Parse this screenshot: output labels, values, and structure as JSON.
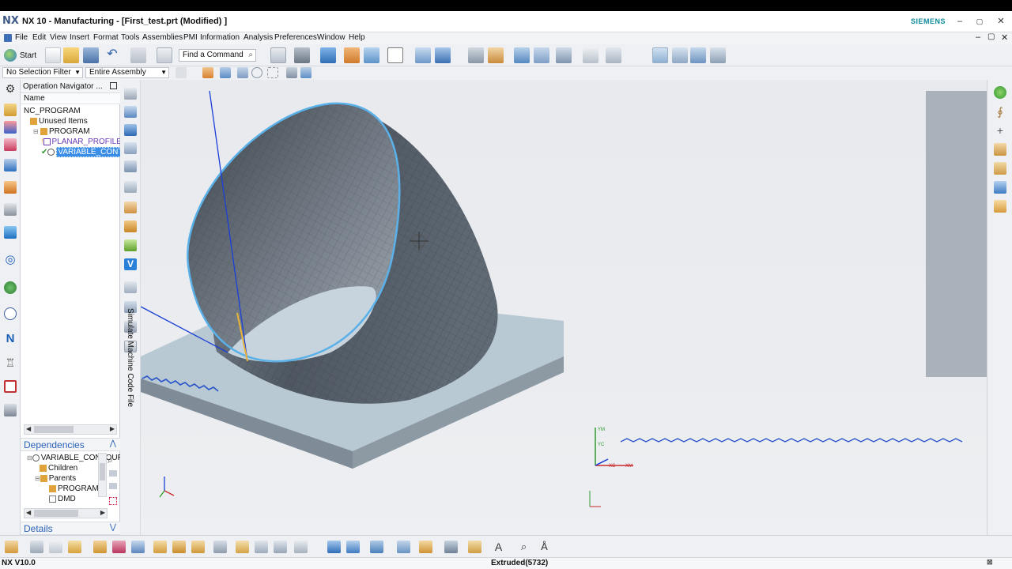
{
  "app": {
    "logo": "NX",
    "title": "NX 10 - Manufacturing - [First_test.prt (Modified) ]",
    "brand": "SIEMENS",
    "window_controls": [
      "–",
      "▢",
      "✕"
    ]
  },
  "menu": {
    "items": [
      "File",
      "Edit",
      "View",
      "Insert",
      "Format",
      "Tools",
      "Assemblies",
      "PMI",
      "Information",
      "Analysis",
      "Preferences",
      "Window",
      "Help"
    ],
    "mdi_controls": [
      "–",
      "▢",
      "✕"
    ]
  },
  "toolbar": {
    "start_label": "Start",
    "find_command_placeholder": "Find a Command"
  },
  "selection": {
    "filter": "No Selection Filter",
    "scope": "Entire Assembly"
  },
  "navigator": {
    "title": "Operation Navigator ...",
    "column_name": "Name",
    "root": "NC_PROGRAM",
    "items": [
      {
        "label": "Unused Items"
      },
      {
        "label": "PROGRAM"
      },
      {
        "label": "PLANAR_PROFILE"
      },
      {
        "label": "VARIABLE_CONTOUR"
      }
    ]
  },
  "dependencies": {
    "title": "Dependencies",
    "selected": "VARIABLE_CONTOUR",
    "children_label": "Children",
    "parents_label": "Parents",
    "parents": [
      "PROGRAM",
      "DMD"
    ]
  },
  "details": {
    "title": "Details"
  },
  "side_panel": {
    "vertical_label": "Simulate Machine Code File"
  },
  "viewport": {
    "axis_labels": [
      "YM",
      "YC",
      "XC",
      "XM",
      "ZC",
      "ZM"
    ]
  },
  "status": {
    "version": "NX V10.0",
    "selection_info": "Extruded(5732)"
  },
  "colors": {
    "accent_blue": "#2a62b8",
    "selection_highlight": "#3b8ee8",
    "surface_highlight": "#5ab0e8",
    "tool_path_blue": "#1a3fd8",
    "brand_teal": "#0d8a9b"
  }
}
